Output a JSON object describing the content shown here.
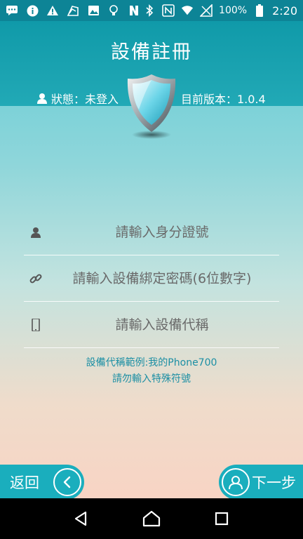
{
  "status_bar": {
    "battery": "100%",
    "time": "2:20"
  },
  "header": {
    "title": "設備註冊",
    "status_text": "狀態：未登入",
    "version_text": "目前版本：1.0.4"
  },
  "form": {
    "id_placeholder": "請輸入身分證號",
    "password_placeholder": "請輸入設備綁定密碼(6位數字)",
    "device_name_placeholder": "請輸入設備代稱"
  },
  "hint": {
    "line1": "設備代稱範例:我的Phone700",
    "line2": "請勿輸入特殊符號"
  },
  "buttons": {
    "back_label": "返回",
    "next_label": "下一步"
  },
  "colors": {
    "header": "#109aa9",
    "accent": "#1aaebd",
    "hint": "#1c8fa4"
  }
}
